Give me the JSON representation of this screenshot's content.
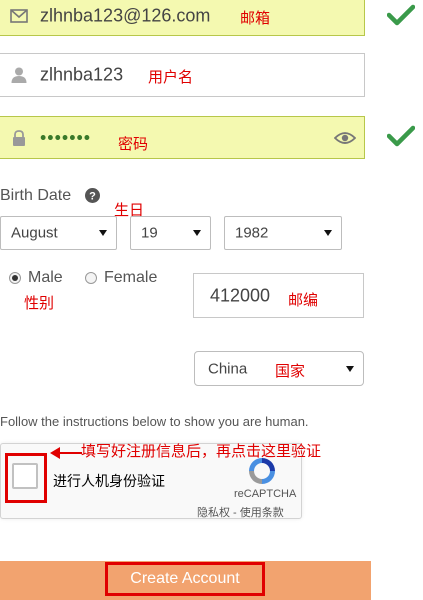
{
  "form": {
    "email": {
      "value": "zlhnba123@126.com",
      "note": "邮箱"
    },
    "username": {
      "value": "zlhnba123",
      "note": "用户名"
    },
    "password": {
      "value": "•••••••",
      "note": "密码"
    },
    "birth_date": {
      "label": "Birth Date",
      "note": "生日",
      "month": "August",
      "day": "19",
      "year": "1982"
    },
    "gender": {
      "male_label": "Male",
      "female_label": "Female",
      "selected": "Male",
      "note": "性别"
    },
    "zip": {
      "value": "412000",
      "note": "邮编"
    },
    "country": {
      "value": "China",
      "note": "国家"
    },
    "captcha": {
      "instructions": "Follow the instructions below to show you are human.",
      "checkbox_label": "进行人机身份验证",
      "brand": "reCAPTCHA",
      "links": "隐私权 - 使用条款",
      "annotation": "填写好注册信息后，再点击这里验证"
    },
    "submit_label": "Create Account"
  },
  "colors": {
    "valid_bg": "#f4f9b0",
    "check_green": "#3a9a4a",
    "annotation_red": "#e00000",
    "button_orange": "#f2a36f"
  },
  "icons": [
    "envelope-icon",
    "user-icon",
    "lock-icon",
    "eye-icon",
    "check-icon",
    "question-icon",
    "recaptcha-logo-icon",
    "arrow-icon"
  ]
}
